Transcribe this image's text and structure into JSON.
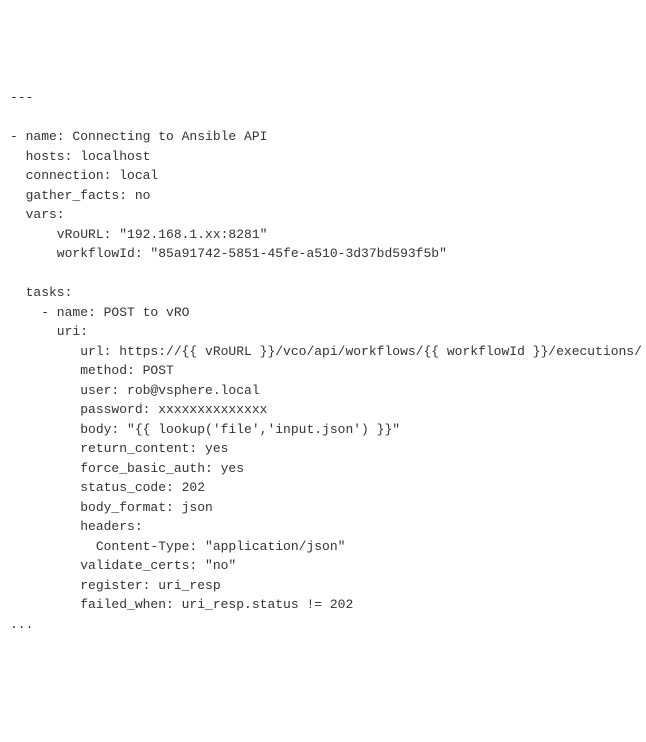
{
  "code": {
    "l01": "---",
    "l02": "",
    "l03": "- name: Connecting to Ansible API",
    "l04": "  hosts: localhost",
    "l05": "  connection: local",
    "l06": "  gather_facts: no",
    "l07": "  vars:",
    "l08": "      vRoURL: \"192.168.1.xx:8281\"",
    "l09": "      workflowId: \"85a91742-5851-45fe-a510-3d37bd593f5b\"",
    "l10": "",
    "l11": "  tasks:",
    "l12": "    - name: POST to vRO",
    "l13": "      uri:",
    "l14": "         url: https://{{ vRoURL }}/vco/api/workflows/{{ workflowId }}/executions/",
    "l15": "         method: POST",
    "l16": "         user: rob@vsphere.local",
    "l17": "         password: xxxxxxxxxxxxxx",
    "l18": "         body: \"{{ lookup('file','input.json') }}\"",
    "l19": "         return_content: yes",
    "l20": "         force_basic_auth: yes",
    "l21": "         status_code: 202",
    "l22": "         body_format: json",
    "l23": "         headers:",
    "l24": "           Content-Type: \"application/json\"",
    "l25": "         validate_certs: \"no\"",
    "l26": "         register: uri_resp",
    "l27": "         failed_when: uri_resp.status != 202",
    "l28": "..."
  }
}
